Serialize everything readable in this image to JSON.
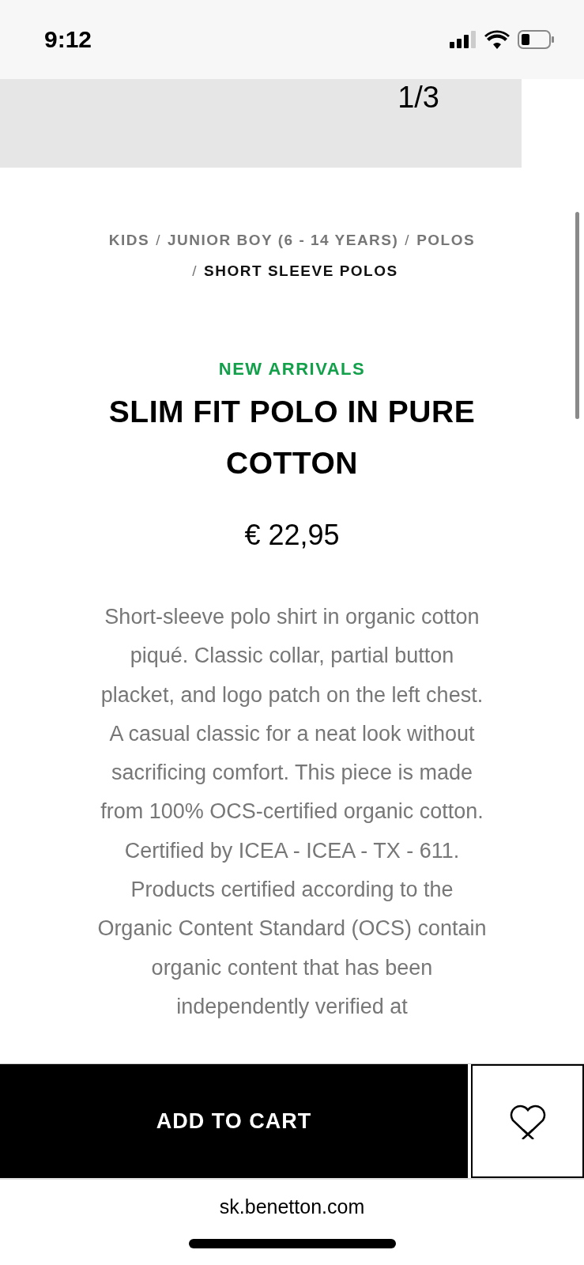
{
  "status_bar": {
    "time": "9:12"
  },
  "gallery": {
    "counter": "1/3"
  },
  "breadcrumb": [
    {
      "label": "KIDS",
      "selected": false
    },
    {
      "label": "JUNIOR BOY (6 - 14 YEARS)",
      "selected": false
    },
    {
      "label": "POLOS",
      "selected": false
    },
    {
      "label": "SHORT SLEEVE POLOS",
      "selected": true
    }
  ],
  "breadcrumb_separator": "/",
  "product": {
    "badge": "NEW ARRIVALS",
    "title": "SLIM FIT POLO IN PURE COTTON",
    "price": "€ 22,95",
    "description": "Short-sleeve polo shirt in organic cotton piqué. Classic collar, partial button placket, and logo patch on the left chest. A casual classic for a neat look without sacrificing comfort. This piece is made from 100% OCS-certified organic cotton. Certified by ICEA - ICEA - TX - 611. Products certified according to the Organic Content Standard (OCS) contain organic content that has been independently verified at"
  },
  "actions": {
    "add_to_cart": "ADD TO CART",
    "wishlisted": false
  },
  "browser": {
    "url": "sk.benetton.com"
  }
}
